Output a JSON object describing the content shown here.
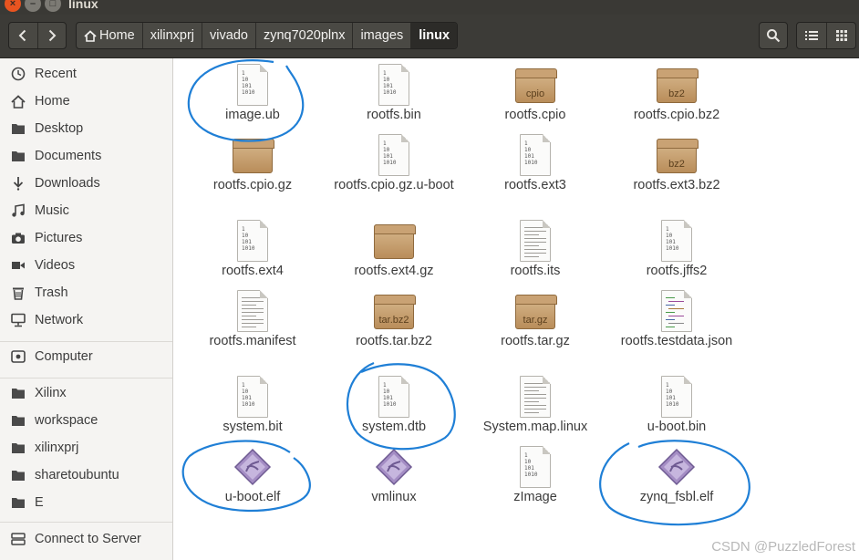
{
  "window": {
    "title": "linux"
  },
  "breadcrumbs": [
    "Home",
    "xilinxprj",
    "vivado",
    "zynq7020plnx",
    "images",
    "linux"
  ],
  "sidebar": {
    "places": [
      {
        "label": "Recent",
        "icon": "clock-icon"
      },
      {
        "label": "Home",
        "icon": "home-icon"
      },
      {
        "label": "Desktop",
        "icon": "folder-icon"
      },
      {
        "label": "Documents",
        "icon": "folder-icon"
      },
      {
        "label": "Downloads",
        "icon": "download-icon"
      },
      {
        "label": "Music",
        "icon": "music-icon"
      },
      {
        "label": "Pictures",
        "icon": "camera-icon"
      },
      {
        "label": "Videos",
        "icon": "video-icon"
      },
      {
        "label": "Trash",
        "icon": "trash-icon"
      },
      {
        "label": "Network",
        "icon": "network-icon"
      }
    ],
    "devices": [
      {
        "label": "Computer",
        "icon": "drive-icon"
      }
    ],
    "bookmarks": [
      {
        "label": "Xilinx",
        "icon": "folder-icon"
      },
      {
        "label": "workspace",
        "icon": "folder-icon"
      },
      {
        "label": "xilinxprj",
        "icon": "folder-icon"
      },
      {
        "label": "sharetoubuntu",
        "icon": "folder-icon"
      },
      {
        "label": "E",
        "icon": "folder-icon"
      }
    ],
    "connect": {
      "label": "Connect to Server",
      "icon": "server-icon"
    }
  },
  "files": [
    {
      "name": "image.ub",
      "type": "binary"
    },
    {
      "name": "rootfs.bin",
      "type": "binary"
    },
    {
      "name": "rootfs.cpio",
      "type": "archive",
      "badge": "cpio"
    },
    {
      "name": "rootfs.cpio.bz2",
      "type": "archive",
      "badge": "bz2"
    },
    {
      "name": "rootfs.cpio.gz",
      "type": "archive",
      "badge": ""
    },
    {
      "name": "rootfs.cpio.gz.u-boot",
      "type": "binary"
    },
    {
      "name": "rootfs.ext3",
      "type": "binary"
    },
    {
      "name": "rootfs.ext3.bz2",
      "type": "archive",
      "badge": "bz2"
    },
    {
      "name": "rootfs.ext4",
      "type": "binary"
    },
    {
      "name": "rootfs.ext4.gz",
      "type": "archive",
      "badge": ""
    },
    {
      "name": "rootfs.its",
      "type": "text"
    },
    {
      "name": "rootfs.jffs2",
      "type": "binary"
    },
    {
      "name": "rootfs.manifest",
      "type": "text"
    },
    {
      "name": "rootfs.tar.bz2",
      "type": "archive",
      "badge": "tar.bz2"
    },
    {
      "name": "rootfs.tar.gz",
      "type": "archive",
      "badge": "tar.gz"
    },
    {
      "name": "rootfs.testdata.json",
      "type": "json"
    },
    {
      "name": "system.bit",
      "type": "binary"
    },
    {
      "name": "system.dtb",
      "type": "binary"
    },
    {
      "name": "System.map.linux",
      "type": "text"
    },
    {
      "name": "u-boot.bin",
      "type": "binary"
    },
    {
      "name": "u-boot.elf",
      "type": "executable"
    },
    {
      "name": "vmlinux",
      "type": "executable"
    },
    {
      "name": "zImage",
      "type": "binary"
    },
    {
      "name": "zynq_fsbl.elf",
      "type": "executable"
    }
  ],
  "binary_glyph": [
    "1",
    "10",
    "101",
    "1010"
  ],
  "highlighted_files": [
    "image.ub",
    "system.dtb",
    "u-boot.elf",
    "zynq_fsbl.elf"
  ],
  "colors": {
    "annotation": "#1f7fd6",
    "accent": "#e95420",
    "toolbar": "#3c3b37"
  },
  "watermark": "CSDN @PuzzledForest"
}
